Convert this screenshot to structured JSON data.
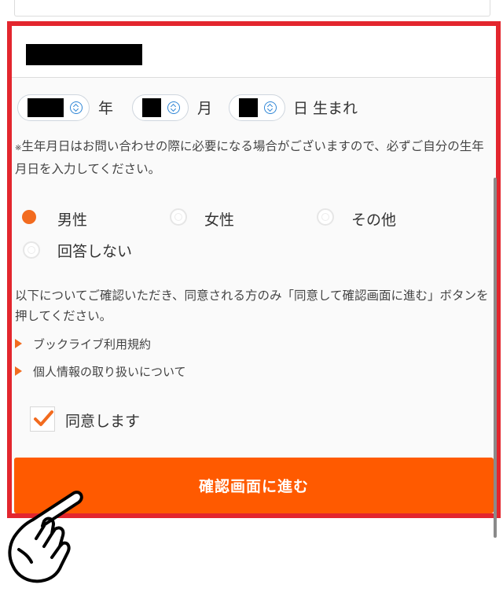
{
  "form": {
    "birthdate": {
      "year_unit": "年",
      "month_unit": "月",
      "day_unit": "日 生まれ",
      "note_asterisk": "※",
      "note_text": "生年月日はお問い合わせの際に必要になる場合がございますので、必ずご自分の生年月日を入力してください。"
    },
    "gender": {
      "options": [
        "男性",
        "女性",
        "その他",
        "回答しない"
      ],
      "selected": "男性"
    },
    "agreement": {
      "intro": "以下についてご確認いただき、同意される方のみ「同意して確認画面に進む」ボタンを押してください。",
      "links": [
        "ブックライブ利用規約",
        "個人情報の取り扱いについて"
      ],
      "checkbox_label": "同意します",
      "checked": true
    },
    "submit_label": "確認画面に進む"
  },
  "colors": {
    "highlight_frame": "#e3262e",
    "accent": "#f26b1f",
    "submit_button": "#ff5a00",
    "select_chevron": "#2f86d6"
  },
  "icons": [
    "chevron-updown-icon",
    "triangle-right-icon",
    "check-icon",
    "pointing-hand-icon"
  ]
}
